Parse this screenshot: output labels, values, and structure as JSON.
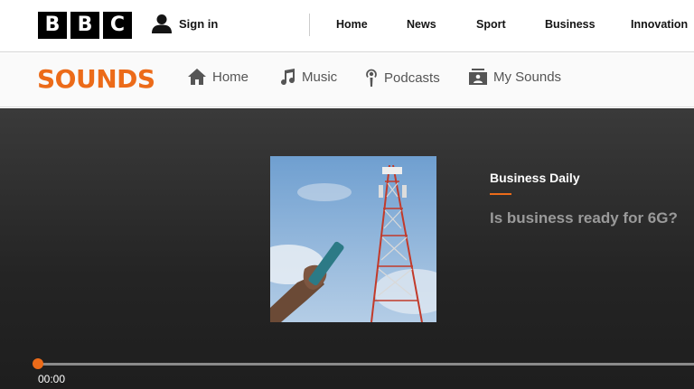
{
  "header": {
    "logo_letters": [
      "B",
      "B",
      "C"
    ],
    "signin_label": "Sign in",
    "nav": [
      "Home",
      "News",
      "Sport",
      "Business",
      "Innovation"
    ]
  },
  "sounds": {
    "logo": "SOUNDS",
    "nav": [
      {
        "label": "Home",
        "icon": "home-icon"
      },
      {
        "label": "Music",
        "icon": "music-note-icon"
      },
      {
        "label": "Podcasts",
        "icon": "podcast-icon"
      },
      {
        "label": "My Sounds",
        "icon": "my-sounds-icon"
      }
    ]
  },
  "player": {
    "show_title": "Business Daily",
    "episode_title": "Is business ready for 6G?",
    "elapsed": "00:00",
    "progress_fraction": 0
  },
  "colors": {
    "accent": "#ec6b19",
    "player_bg": "#2a2a2a"
  }
}
